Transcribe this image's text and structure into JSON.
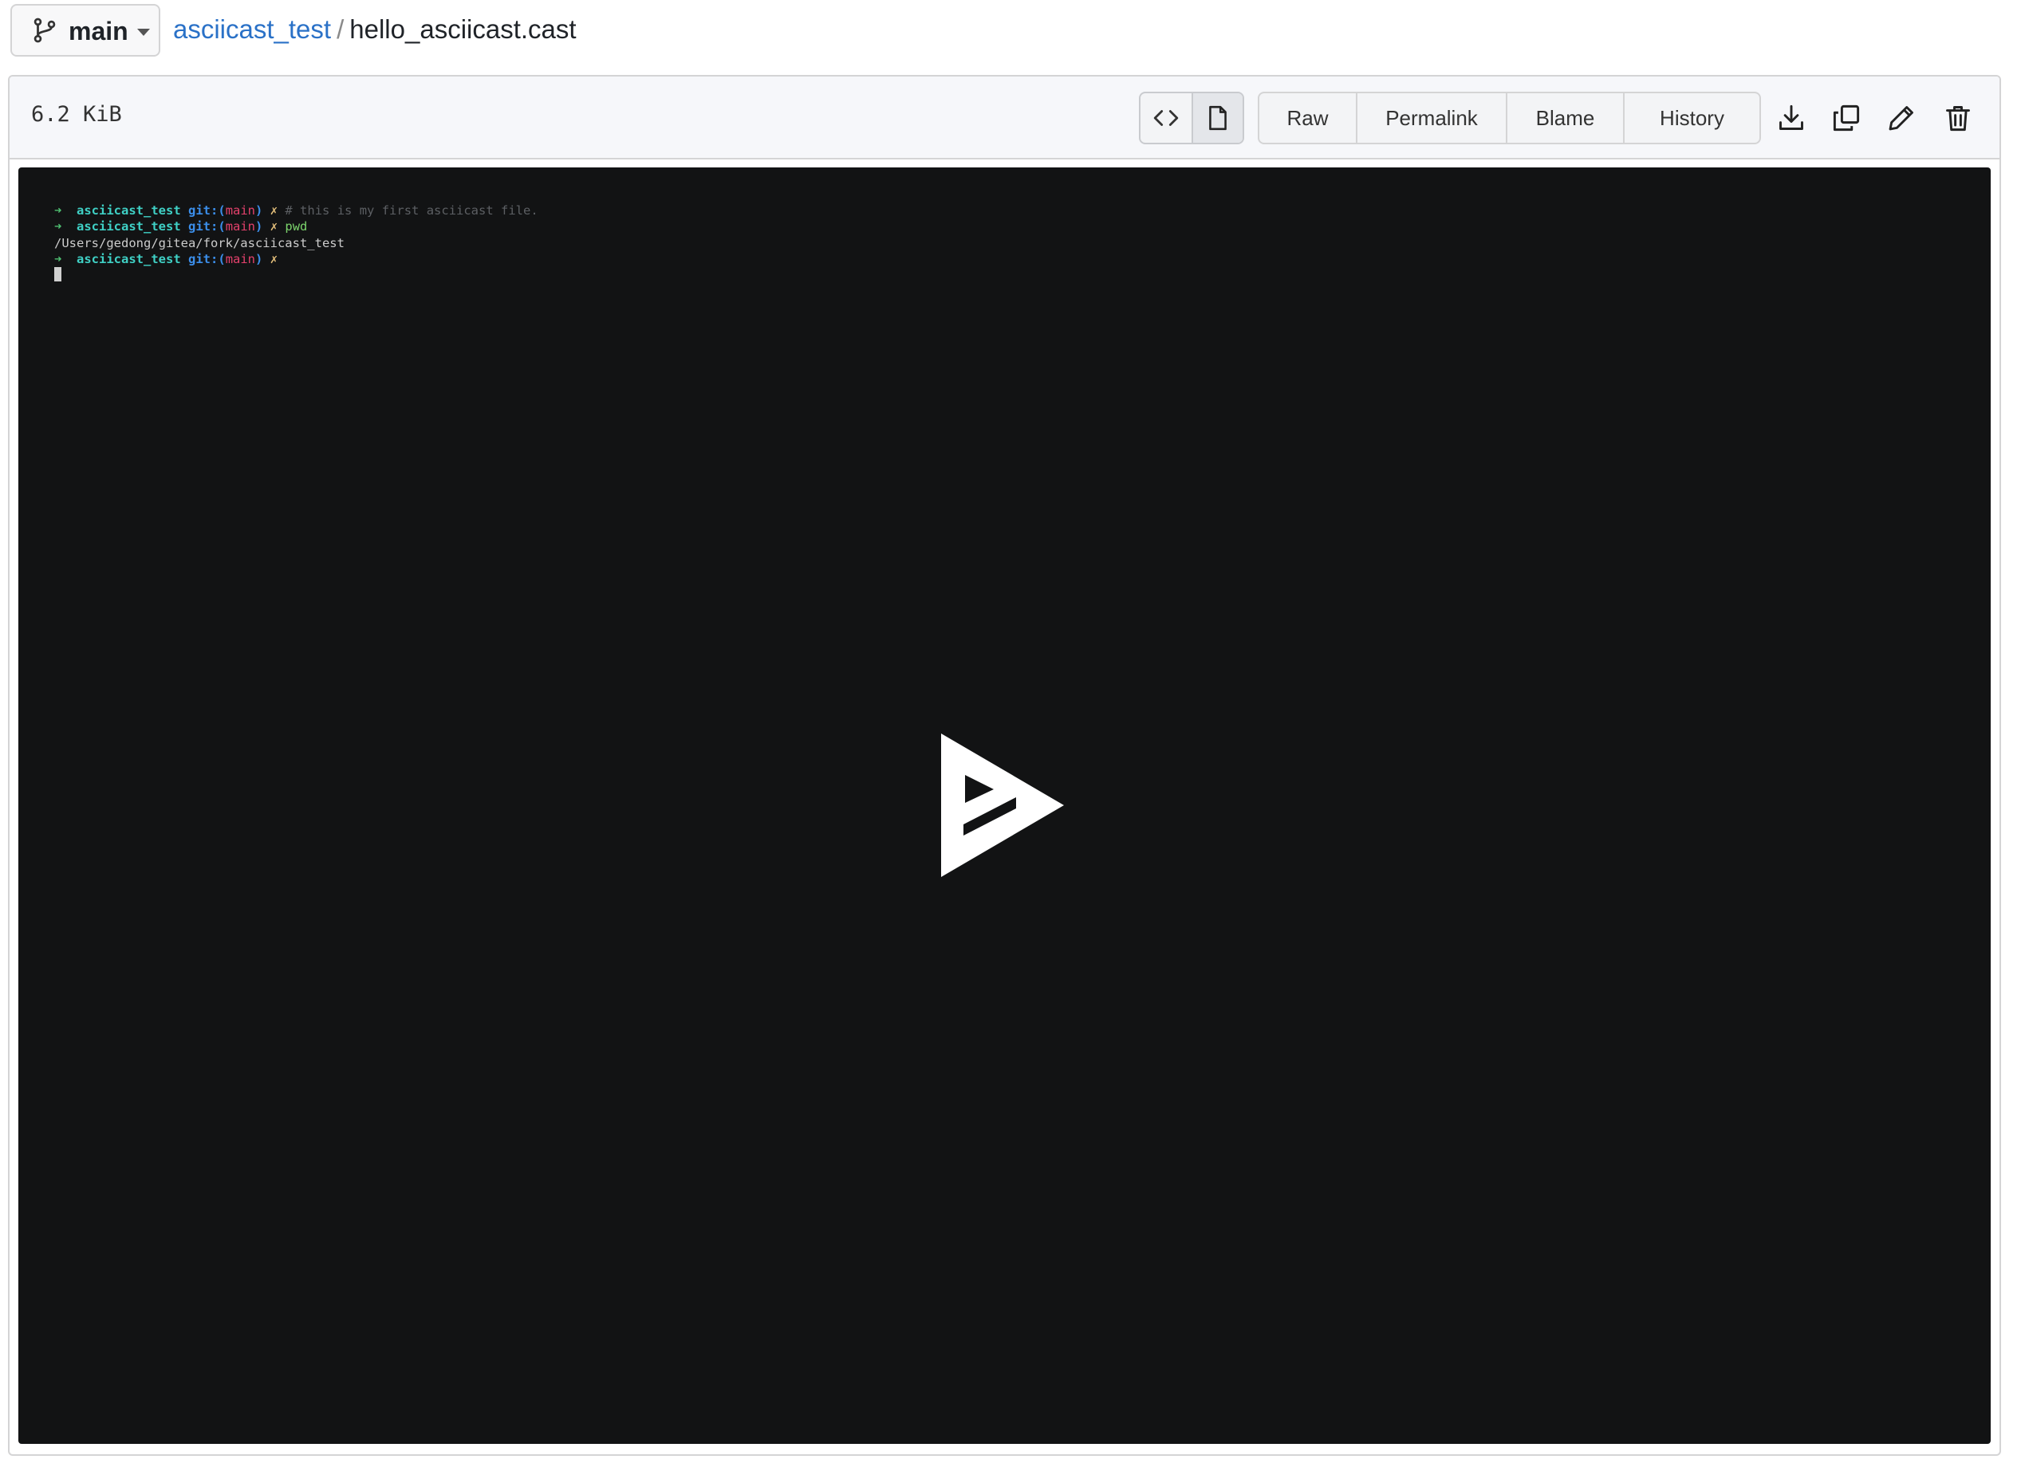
{
  "branch": {
    "icon": "git-branch-icon",
    "label": "main"
  },
  "breadcrumb": {
    "repo": "asciicast_test",
    "separator": "/",
    "file": "hello_asciicast.cast"
  },
  "file_header": {
    "size": "6.2 KiB",
    "view_toggle": [
      {
        "icon": "code-icon"
      },
      {
        "icon": "file-icon"
      }
    ],
    "buttons": {
      "raw": "Raw",
      "permalink": "Permalink",
      "blame": "Blame",
      "history": "History"
    },
    "actions": [
      "download-icon",
      "copy-icon",
      "edit-icon",
      "delete-icon"
    ]
  },
  "terminal": {
    "lines": [
      {
        "arrow": "➜",
        "dir": "asciicast_test",
        "git": "git:(",
        "branch": "main",
        "git_close": ")",
        "mark": "✗",
        "comment": "# this is my first asciicast file.",
        "command": ""
      },
      {
        "arrow": "➜",
        "dir": "asciicast_test",
        "git": "git:(",
        "branch": "main",
        "git_close": ")",
        "mark": "✗",
        "comment": "",
        "command": "pwd"
      },
      {
        "output": "/Users/gedong/gitea/fork/asciicast_test"
      },
      {
        "arrow": "➜",
        "dir": "asciicast_test",
        "git": "git:(",
        "branch": "main",
        "git_close": ")",
        "mark": "✗",
        "comment": "",
        "command": ""
      }
    ],
    "play_icon": "asciinema-play-icon"
  },
  "colors": {
    "link": "#2a71c7",
    "player_bg": "#121314",
    "prompt_dir": "#3fd0c5",
    "prompt_git": "#3b8eea",
    "prompt_branch": "#e4416c"
  }
}
